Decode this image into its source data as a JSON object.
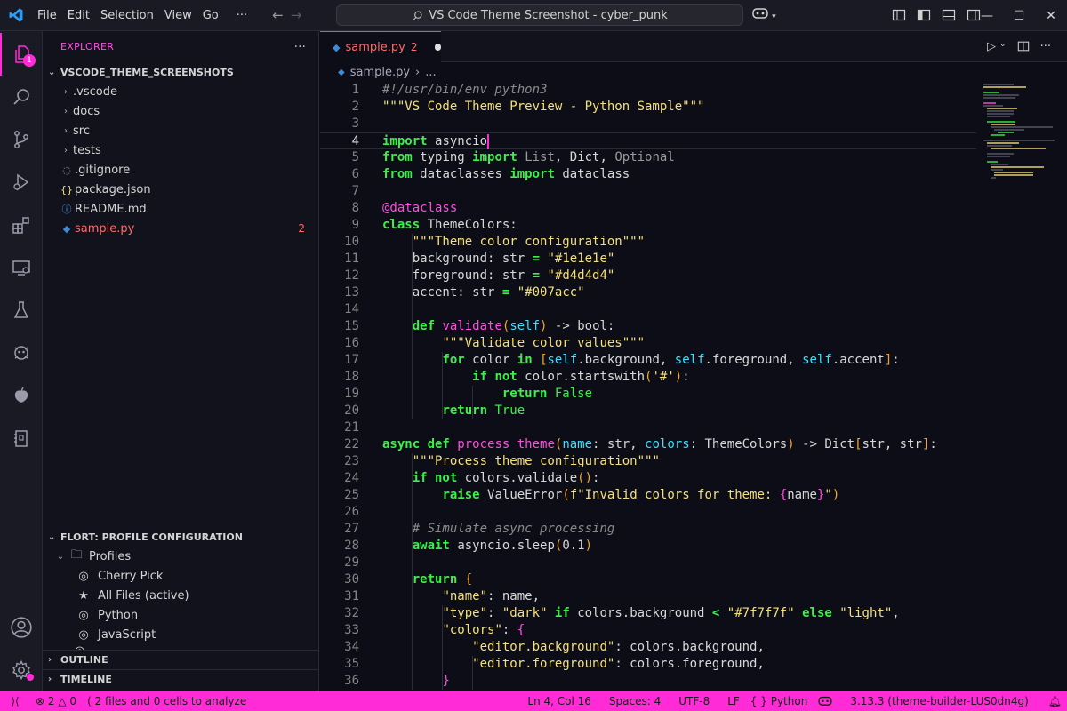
{
  "titlebar": {
    "menu": [
      "File",
      "Edit",
      "Selection",
      "View",
      "Go"
    ],
    "more": "···",
    "command_center": "VS Code Theme Screenshot - cyber_punk"
  },
  "activity": {
    "explorer_badge": "1"
  },
  "sidebar": {
    "title": "EXPLORER",
    "workspace": "VSCODE_THEME_SCREENSHOTS",
    "items": [
      {
        "label": ".vscode",
        "kind": "folder"
      },
      {
        "label": "docs",
        "kind": "folder"
      },
      {
        "label": "src",
        "kind": "folder"
      },
      {
        "label": "tests",
        "kind": "folder"
      },
      {
        "label": ".gitignore",
        "kind": "file"
      },
      {
        "label": "package.json",
        "kind": "json"
      },
      {
        "label": "README.md",
        "kind": "info"
      },
      {
        "label": "sample.py",
        "kind": "python",
        "count": "2"
      }
    ],
    "profile_section": "FLORT: PROFILE CONFIGURATION",
    "profiles_label": "Profiles",
    "profiles": [
      "Cherry Pick",
      "All Files (active)",
      "Python",
      "JavaScript"
    ],
    "outline": "OUTLINE",
    "timeline": "TIMELINE"
  },
  "editor": {
    "tab_name": "sample.py",
    "tab_count": "2",
    "breadcrumb_file": "sample.py",
    "breadcrumb_more": "...",
    "current_line": 4
  },
  "status": {
    "errors": "2",
    "warnings": "0",
    "analyze": "2 files and 0 cells to analyze",
    "position": "Ln 4, Col 16",
    "spaces": "Spaces: 4",
    "encoding": "UTF-8",
    "eol": "LF",
    "language": "Python",
    "interpreter": "3.13.3 (theme-builder-LUS0dn4g)"
  },
  "colors": {
    "accent": "#ff2bd6",
    "keyword": "#3cf04a",
    "string": "#f4e07a"
  }
}
